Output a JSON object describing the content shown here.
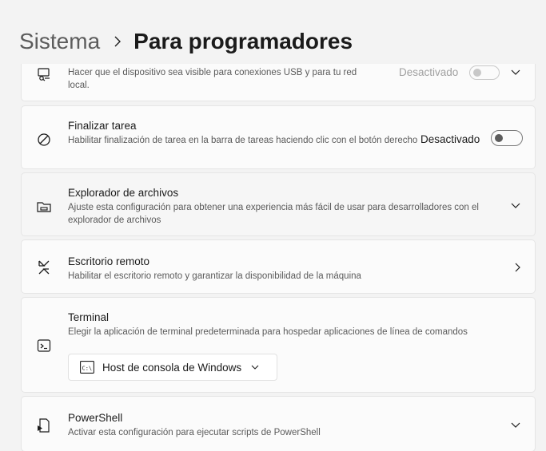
{
  "breadcrumb": {
    "parent": "Sistema",
    "current": "Para programadores"
  },
  "settings": {
    "device_portal": {
      "desc": "Hacer que el dispositivo sea visible para conexiones USB y para tu red local.",
      "state": "Desactivado",
      "icon": "device-discovery-icon"
    },
    "end_task": {
      "title": "Finalizar tarea",
      "desc": "Habilitar finalización de tarea en la barra de tareas haciendo clic con el botón derecho",
      "state": "Desactivado",
      "icon": "end-task-icon"
    },
    "file_explorer": {
      "title": "Explorador de archivos",
      "desc": "Ajuste esta configuración para obtener una experiencia más fácil de usar para desarrolladores con el explorador de archivos",
      "icon": "folder-icon"
    },
    "remote_desktop": {
      "title": "Escritorio remoto",
      "desc": "Habilitar el escritorio remoto y garantizar la disponibilidad de la máquina",
      "icon": "remote-desktop-icon"
    },
    "terminal": {
      "title": "Terminal",
      "desc": "Elegir la aplicación de terminal predeterminada para hospedar aplicaciones de línea de comandos",
      "selected": "Host de consola de Windows",
      "icon": "terminal-icon"
    },
    "powershell": {
      "title": "PowerShell",
      "desc": "Activar esta configuración para ejecutar scripts de PowerShell",
      "icon": "powershell-icon"
    }
  }
}
